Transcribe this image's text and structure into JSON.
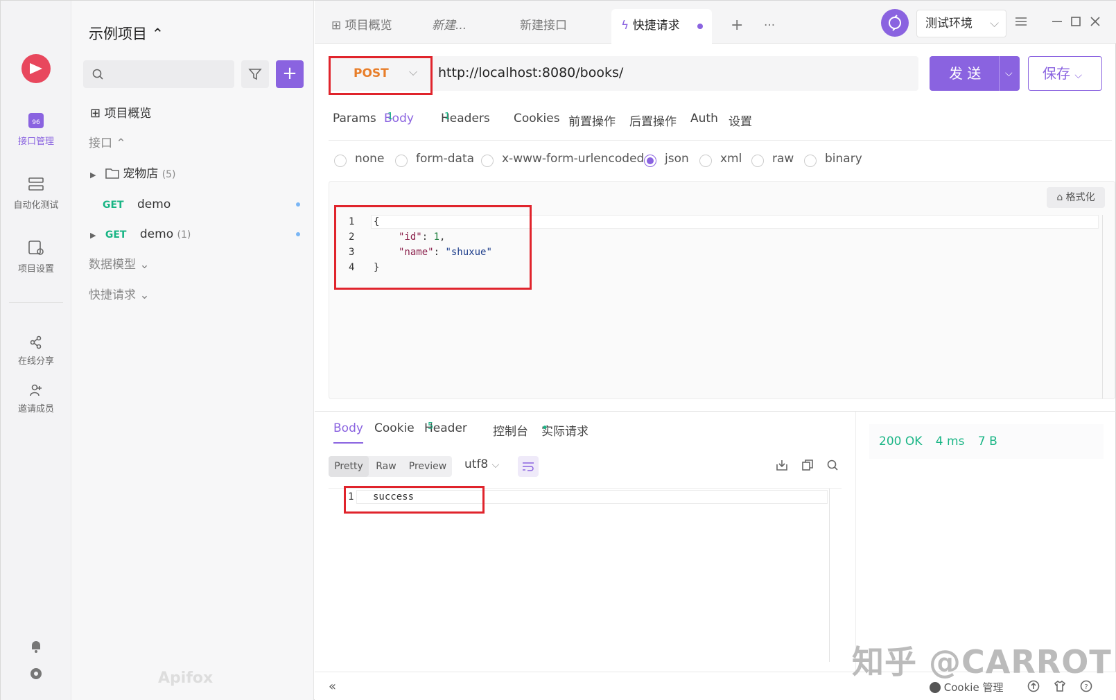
{
  "rail": {
    "items": [
      {
        "label": "接口管理",
        "icon": "api-icon",
        "active": true
      },
      {
        "label": "自动化测试",
        "icon": "automation-icon"
      },
      {
        "label": "项目设置",
        "icon": "project-settings-icon"
      },
      {
        "label": "在线分享",
        "icon": "share-icon"
      },
      {
        "label": "邀请成员",
        "icon": "invite-icon"
      }
    ],
    "badge_text": "96"
  },
  "tree": {
    "project_name": "示例项目 ⌃",
    "overview": "项目概览",
    "section_api": "接口 ⌃",
    "folder_name": "宠物店",
    "folder_count": "(5)",
    "items": [
      {
        "method": "GET",
        "name": "demo",
        "count": ""
      },
      {
        "method": "GET",
        "name": "demo",
        "count": "(1)"
      }
    ],
    "section_models": "数据模型 ⌄",
    "section_quick": "快捷请求 ⌄",
    "brand": "Apifox"
  },
  "tabs": {
    "items": [
      {
        "label": "项目概览"
      },
      {
        "label": "新建..."
      },
      {
        "label": "新建接口"
      },
      {
        "label": "快捷请求",
        "active": true
      }
    ],
    "add": "+",
    "more": "···",
    "environment": "测试环境"
  },
  "request": {
    "method": "POST",
    "url": "http://localhost:8080/books/",
    "send_label": "发 送",
    "save_label": "保存",
    "tabs": [
      {
        "label": "Params",
        "badge": ""
      },
      {
        "label": "Body",
        "badge": "1",
        "active": true
      },
      {
        "label": "Headers",
        "badge": "1"
      },
      {
        "label": "Cookies",
        "badge": ""
      },
      {
        "label": "前置操作",
        "badge": ""
      },
      {
        "label": "后置操作",
        "badge": ""
      },
      {
        "label": "Auth",
        "badge": ""
      },
      {
        "label": "设置",
        "badge": ""
      }
    ],
    "body_types": [
      "none",
      "form-data",
      "x-www-form-urlencoded",
      "json",
      "xml",
      "raw",
      "binary"
    ],
    "body_type_selected": "json",
    "format_label": "格式化",
    "code_lines": [
      {
        "no": "1",
        "text": "{"
      },
      {
        "no": "2",
        "key": "\"id\"",
        "value": "1",
        "suffix": ","
      },
      {
        "no": "3",
        "key": "\"name\"",
        "value": "\"shuxue\"",
        "suffix": ""
      },
      {
        "no": "4",
        "text": "}"
      }
    ]
  },
  "response": {
    "tabs": [
      {
        "label": "Body",
        "badge": "",
        "active": true
      },
      {
        "label": "Cookie",
        "badge": ""
      },
      {
        "label": "Header",
        "badge": "5"
      },
      {
        "label": "控制台",
        "badge": ""
      },
      {
        "label": "实际请求",
        "badge": "•"
      }
    ],
    "view_modes": [
      "Pretty",
      "Raw",
      "Preview"
    ],
    "encoding": "utf8",
    "lines": [
      {
        "no": "1",
        "text": "success"
      }
    ],
    "status": "200 OK",
    "time": "4 ms",
    "size": "7 B"
  },
  "footer": {
    "cookie_label": "Cookie 管理"
  },
  "watermark": "知乎 @CARROT",
  "colors": {
    "accent": "#8a63e0",
    "method_post": "#e87e2a",
    "method_get": "#19b585",
    "highlight_box": "#e0242c"
  }
}
